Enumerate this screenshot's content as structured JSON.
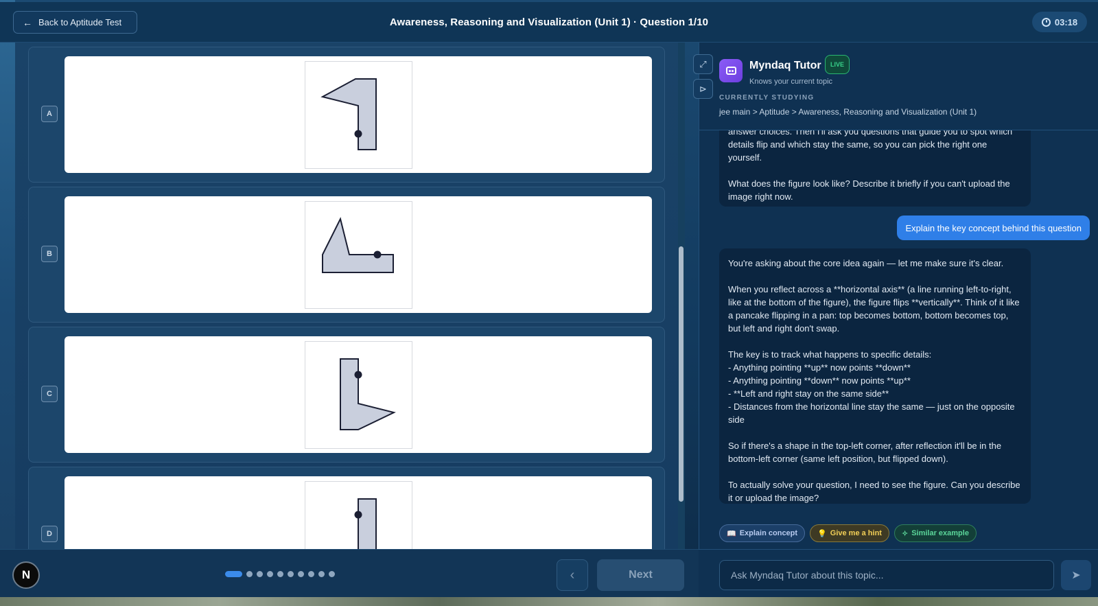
{
  "header": {
    "back_label": "Back to Aptitude Test",
    "title": "Awareness, Reasoning and Visualization (Unit 1) · Question 1/10",
    "timer": "03:18"
  },
  "options": [
    {
      "label": "A"
    },
    {
      "label": "B"
    },
    {
      "label": "C"
    },
    {
      "label": "D"
    }
  ],
  "navigation": {
    "avatar_letter": "N",
    "total_questions": 10,
    "current_question": 1,
    "next_label": "Next"
  },
  "tutor": {
    "name": "Myndaq Tutor",
    "live_badge": "LIVE",
    "subtitle": "Knows your current topic",
    "studying_label": "CURRENTLY STUDYING",
    "breadcrumb": "jee main > Aptitude > Awareness, Reasoning and Visualization (Unit 1)",
    "messages": [
      {
        "role": "bot",
        "text": "answer choices. Then I'll ask you questions that guide you to spot which details flip and which stay the same, so you can pick the right one yourself.\n\nWhat does the figure look like? Describe it briefly if you can't upload the image right now."
      },
      {
        "role": "user",
        "text": "Explain the key concept behind this question"
      },
      {
        "role": "bot",
        "text": "You're asking about the core idea again — let me make sure it's clear.\n\nWhen you reflect across a **horizontal axis** (a line running left-to-right, like at the bottom of the figure), the figure flips **vertically**. Think of it like a pancake flipping in a pan: top becomes bottom, bottom becomes top, but left and right don't swap.\n\nThe key is to track what happens to specific details:\n- Anything pointing **up** now points **down**\n- Anything pointing **down** now points **up**\n- **Left and right stay on the same side**\n- Distances from the horizontal line stay the same — just on the opposite side\n\nSo if there's a shape in the top-left corner, after reflection it'll be in the bottom-left corner (same left position, but flipped down).\n\nTo actually solve your question, I need to see the figure. Can you describe it or upload the image?"
      }
    ],
    "chips": {
      "explain": "Explain concept",
      "hint": "Give me a hint",
      "similar": "Similar example"
    },
    "input_placeholder": "Ask Myndaq Tutor about this topic..."
  }
}
